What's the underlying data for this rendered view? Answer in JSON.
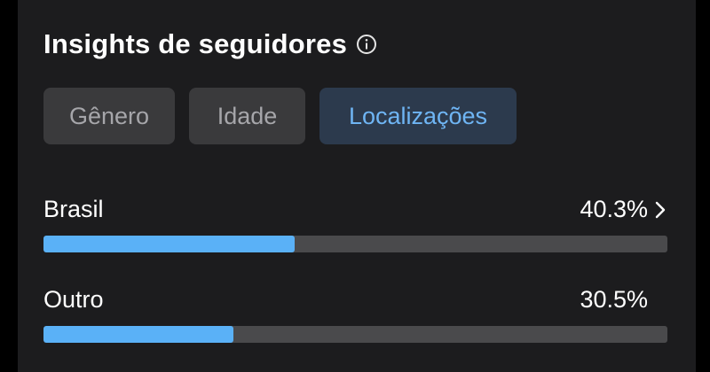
{
  "header": {
    "title": "Insights de seguidores",
    "info_icon": "info-circle-icon"
  },
  "tabs": [
    {
      "label": "Gênero",
      "active": false
    },
    {
      "label": "Idade",
      "active": false
    },
    {
      "label": "Localizações",
      "active": true
    }
  ],
  "locations": [
    {
      "label": "Brasil",
      "value": "40.3%",
      "percent": 40.3,
      "has_chevron": true
    },
    {
      "label": "Outro",
      "value": "30.5%",
      "percent": 30.5,
      "has_chevron": false
    }
  ],
  "colors": {
    "background": "#000000",
    "card": "#1c1c1e",
    "tab_bg": "#3a3a3c",
    "tab_active_bg": "#2c3a4d",
    "accent": "#5ab1f7",
    "track": "#4a4a4c"
  }
}
